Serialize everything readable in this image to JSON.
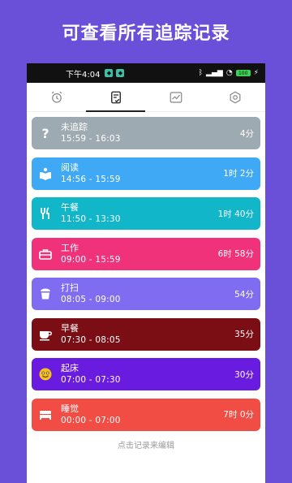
{
  "banner": {
    "title": "可查看所有追踪记录"
  },
  "statusbar": {
    "time": "下午4:04",
    "battery": "100"
  },
  "tabs": [
    {
      "name": "alarm-clock-icon",
      "active": false
    },
    {
      "name": "checklist-icon",
      "active": true
    },
    {
      "name": "chart-icon",
      "active": false
    },
    {
      "name": "gear-icon",
      "active": false
    }
  ],
  "records": [
    {
      "name": "未追踪",
      "time": "15:59  -  16:03",
      "duration": "4分",
      "color": "#9eaab1",
      "icon": "question-icon"
    },
    {
      "name": "阅读",
      "time": "14:56  -  15:59",
      "duration": "1时 2分",
      "color": "#3fa9f5",
      "icon": "book-icon"
    },
    {
      "name": "午餐",
      "time": "11:50  -  13:30",
      "duration": "1时 40分",
      "color": "#12b6c9",
      "icon": "fork-knife-icon"
    },
    {
      "name": "工作",
      "time": "09:00  -  15:59",
      "duration": "6时 58分",
      "color": "#f0327a",
      "icon": "briefcase-icon"
    },
    {
      "name": "打扫",
      "time": "08:05  -  09:00",
      "duration": "54分",
      "color": "#7f6cf0",
      "icon": "trash-icon"
    },
    {
      "name": "早餐",
      "time": "07:30  -  08:05",
      "duration": "35分",
      "color": "#7a0e14",
      "icon": "coffee-icon"
    },
    {
      "name": "起床",
      "time": "07:00  -  07:30",
      "duration": "30分",
      "color": "#6a1be0",
      "icon": "smile-icon"
    },
    {
      "name": "睡觉",
      "time": "00:00  -  07:00",
      "duration": "7时 0分",
      "color": "#f24d44",
      "icon": "bed-icon"
    }
  ],
  "hint": "点击记录来编辑"
}
